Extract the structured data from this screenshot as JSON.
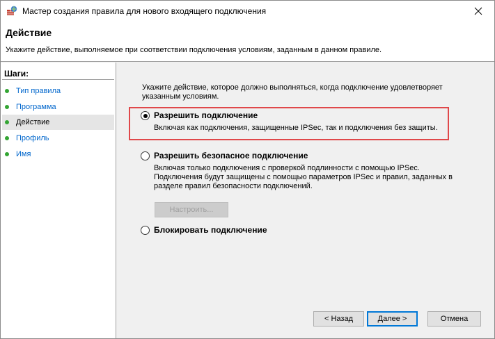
{
  "window": {
    "title": "Мастер создания правила для нового входящего подключения",
    "close_icon": "close-icon"
  },
  "header": {
    "title": "Действие",
    "description": "Укажите действие, выполняемое при соответствии подключения условиям, заданным в данном правиле."
  },
  "steps": {
    "title": "Шаги:",
    "items": [
      {
        "label": "Тип правила",
        "current": false
      },
      {
        "label": "Программа",
        "current": false
      },
      {
        "label": "Действие",
        "current": true
      },
      {
        "label": "Профиль",
        "current": false
      },
      {
        "label": "Имя",
        "current": false
      }
    ]
  },
  "main": {
    "intro": "Укажите действие, которое должно выполняться, когда подключение удовлетворяет указанным условиям.",
    "options": [
      {
        "label": "Разрешить подключение",
        "description": "Включая как подключения, защищенные IPSec, так и подключения без защиты.",
        "selected": true
      },
      {
        "label": "Разрешить безопасное подключение",
        "description": "Включая только подключения с проверкой подлинности с помощью IPSec. Подключения будут защищены с помощью параметров IPSec и правил, заданных в разделе правил безопасности подключений.",
        "selected": false
      },
      {
        "label": "Блокировать подключение",
        "description": "",
        "selected": false
      }
    ],
    "customize_label": "Настроить..."
  },
  "buttons": {
    "back": "< Назад",
    "next": "Далее >",
    "cancel": "Отмена"
  },
  "colors": {
    "highlight_border": "#e0484a",
    "step_dot": "#33a533",
    "link": "#0066cc"
  }
}
